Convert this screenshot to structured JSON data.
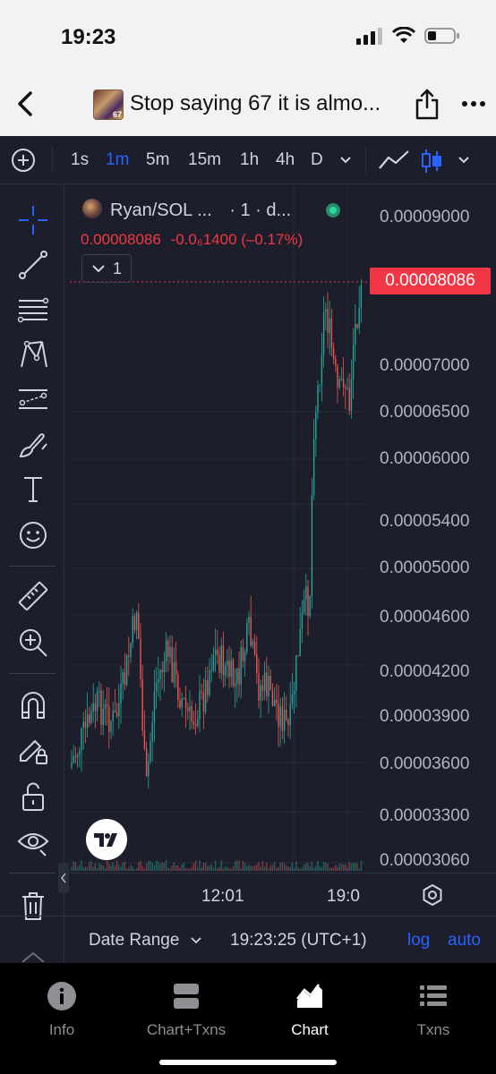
{
  "status": {
    "time": "19:23"
  },
  "header": {
    "title": "Stop saying 67 it is almo..."
  },
  "toolbar": {
    "timeframes": [
      "1s",
      "1m",
      "5m",
      "15m",
      "1h",
      "4h",
      "D"
    ],
    "active_timeframe": "1m"
  },
  "legend": {
    "pair": "Ryan/SOL ...",
    "interval": "· 1 · d...",
    "price": "0.00008086",
    "change": "-0.0₆1400 (–0.17%)",
    "indicator_count": "1"
  },
  "price_axis": {
    "labels": [
      "0.00009000",
      "0.00007000",
      "0.00006500",
      "0.00006000",
      "0.00005400",
      "0.00005000",
      "0.00004600",
      "0.00004200",
      "0.00003900",
      "0.00003600",
      "0.00003300",
      "0.00003060"
    ],
    "current_price": "0.00008086",
    "scale": "log",
    "colors": {
      "up": "#26a69a",
      "down": "#ef5350",
      "current": "#f23645"
    }
  },
  "time_axis": {
    "labels": [
      "12:01",
      "19:0"
    ]
  },
  "bottom": {
    "date_range": "Date Range",
    "clock": "19:23:25 (UTC+1)",
    "log": "log",
    "auto": "auto"
  },
  "tabs": [
    {
      "label": "Info",
      "icon": "info-icon"
    },
    {
      "label": "Chart+Txns",
      "icon": "split-view-icon"
    },
    {
      "label": "Chart",
      "icon": "chart-icon",
      "active": true
    },
    {
      "label": "Txns",
      "icon": "list-icon"
    }
  ]
}
